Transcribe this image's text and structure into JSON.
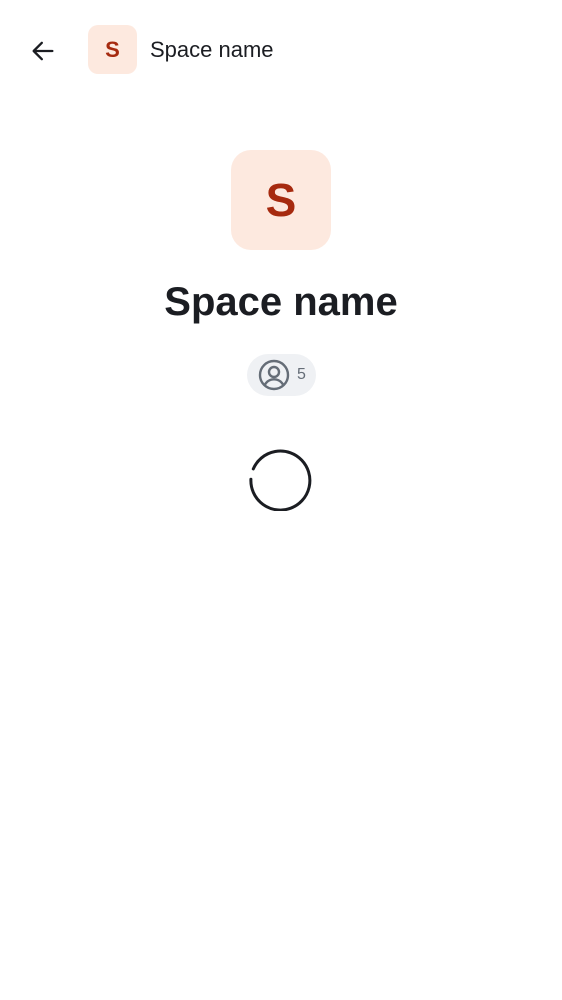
{
  "header": {
    "back_icon": "arrow-left-icon",
    "avatar_letter": "S",
    "title": "Space name"
  },
  "space": {
    "avatar_letter": "S",
    "name": "Space name",
    "member_icon": "user-circle-icon",
    "member_count": "5"
  },
  "loading": {
    "icon": "loading-spinner"
  },
  "colors": {
    "avatar_bg": "#fde9df",
    "avatar_text": "#a62a0f",
    "chip_bg": "#eff1f4",
    "chip_text": "#656d77",
    "text_primary": "#1b1d22"
  }
}
